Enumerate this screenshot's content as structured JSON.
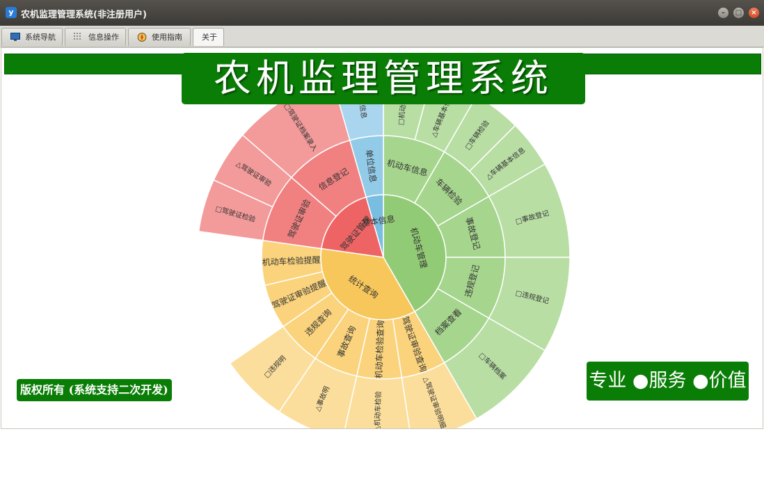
{
  "window": {
    "title": "农机监理管理系统(非注册用户)"
  },
  "tabs": [
    {
      "label": "系统导航",
      "icon": "monitor-icon"
    },
    {
      "label": "信息操作",
      "icon": "grid-icon"
    },
    {
      "label": "使用指南",
      "icon": "compass-icon"
    },
    {
      "label": "关于",
      "icon": ""
    }
  ],
  "banner": {
    "title": "农机监理管理系统"
  },
  "footer": {
    "copyright": "版权所有 (系统支持二次开发)",
    "slogan": "专业 ●服务 ●价值"
  },
  "colors": {
    "green_brand": "#0a7d06",
    "jidongche": [
      "#92cb75",
      "#a6d58d",
      "#b8dea4"
    ],
    "tongji": [
      "#f8c75c",
      "#fad37c",
      "#fbde9b"
    ],
    "jiashi": [
      "#ee6464",
      "#f18181",
      "#f39a9a"
    ],
    "jiben": [
      "#79bde0",
      "#92cbe8",
      "#a9d6ee"
    ]
  },
  "chart_data": {
    "type": "sunburst",
    "title": "",
    "nodes": [
      {
        "name": "机动车管理",
        "children": [
          {
            "name": "机动车信息",
            "children": [
              {
                "name": "□机动车信息"
              },
              {
                "name": "△车辆基本信息"
              }
            ]
          },
          {
            "name": "车辆检验",
            "children": [
              {
                "name": "□车辆检验"
              },
              {
                "name": "△车辆基本信息"
              }
            ]
          },
          {
            "name": "事故登记",
            "children": [
              {
                "name": "□事故登记"
              }
            ]
          },
          {
            "name": "违规登记",
            "children": [
              {
                "name": "□违规登记"
              }
            ]
          },
          {
            "name": "档案查看",
            "children": [
              {
                "name": "□车辆档案"
              }
            ]
          }
        ]
      },
      {
        "name": "统计查询",
        "children": [
          {
            "name": "驾驶证审验查询",
            "children": [
              {
                "name": "△驾驶证审验明细"
              }
            ]
          },
          {
            "name": "机动车检验查询",
            "children": [
              {
                "name": "△机动车检验"
              }
            ]
          },
          {
            "name": "事故查询",
            "children": [
              {
                "name": "△事故明"
              }
            ]
          },
          {
            "name": "违规查询",
            "children": [
              {
                "name": "□违规明"
              }
            ]
          },
          {
            "name": "驾驶证审验提醒",
            "children": []
          },
          {
            "name": "机动车检验提醒",
            "children": []
          }
        ]
      },
      {
        "name": "驾驶证管理",
        "children": [
          {
            "name": "驾驶证审验",
            "children": [
              {
                "name": "□驾驶证检验"
              },
              {
                "name": "△驾驶证审验"
              }
            ]
          },
          {
            "name": "信息登记",
            "children": [
              {
                "name": "□驾驶证档案录入"
              }
            ]
          }
        ]
      },
      {
        "name": "基本信息",
        "children": [
          {
            "name": "单位信息",
            "children": [
              {
                "name": "单位信息"
              }
            ]
          }
        ]
      }
    ]
  }
}
